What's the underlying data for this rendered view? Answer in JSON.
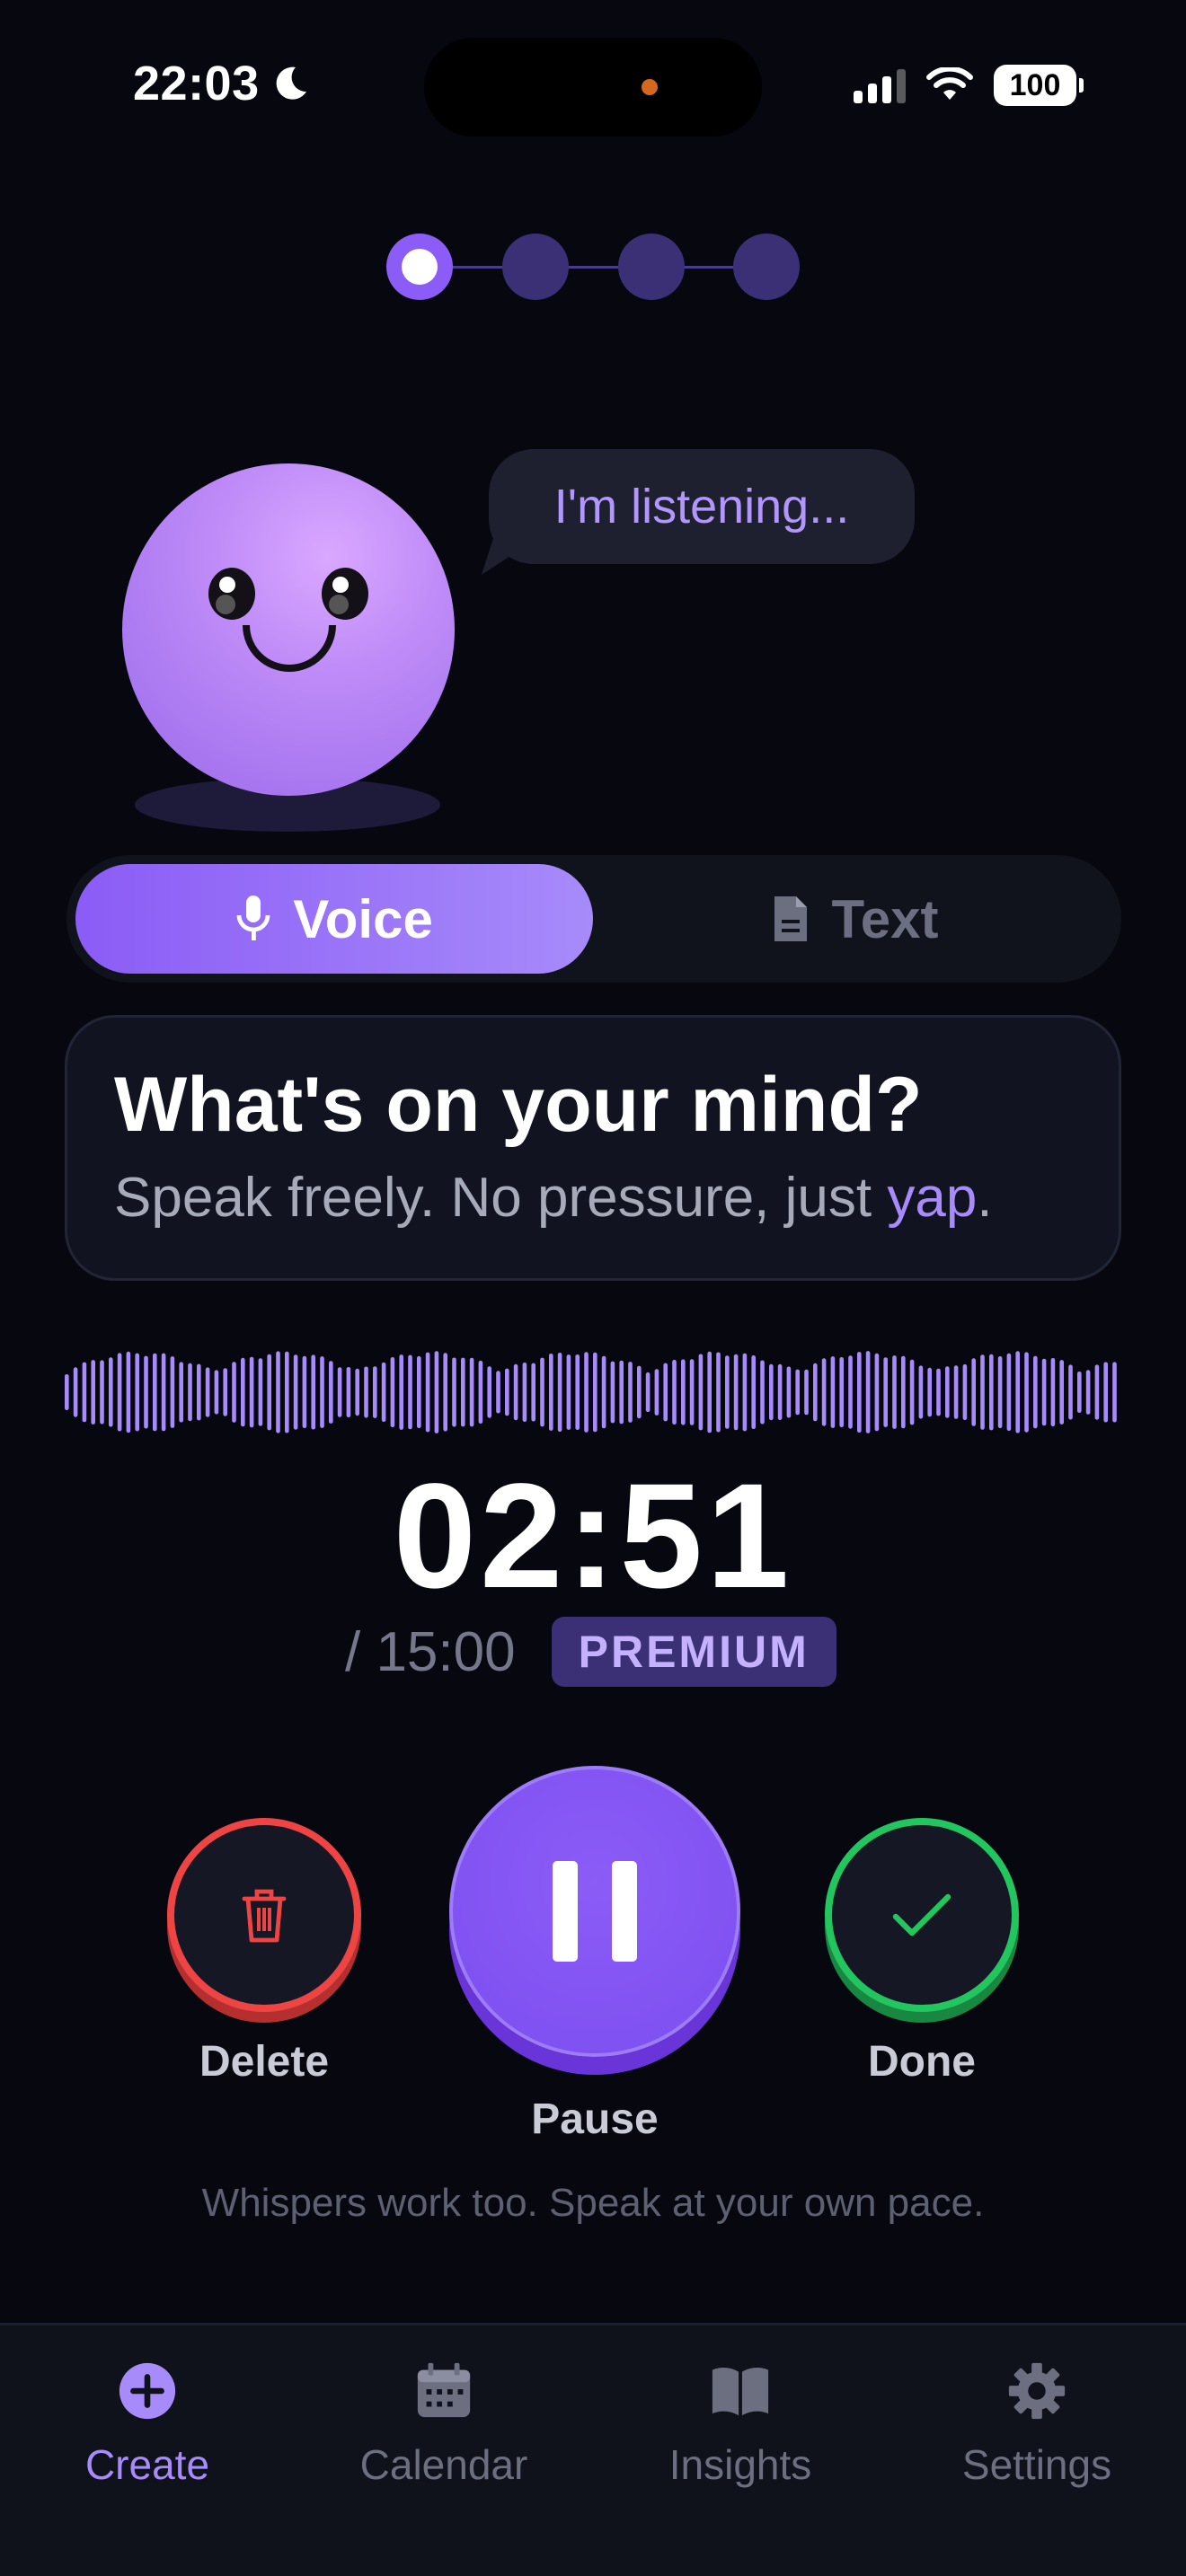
{
  "status_bar": {
    "time": "22:03",
    "battery": "100"
  },
  "stepper": {
    "total_steps": 4,
    "current_step": 1
  },
  "mascot": {
    "speech": "I'm listening..."
  },
  "mode_toggle": {
    "voice_label": "Voice",
    "text_label": "Text",
    "selected": "Voice"
  },
  "prompt": {
    "title": "What's on your mind?",
    "subtitle_prefix": "Speak freely. No pressure, just ",
    "subtitle_highlight": "yap",
    "subtitle_suffix": "."
  },
  "recording": {
    "elapsed": "02:51",
    "limit": "/ 15:00",
    "tier_badge": "PREMIUM"
  },
  "controls": {
    "delete_label": "Delete",
    "pause_label": "Pause",
    "done_label": "Done"
  },
  "hint": "Whispers work too. Speak at your own pace.",
  "tabs": [
    {
      "label": "Create",
      "icon": "plus-circle-icon",
      "active": true
    },
    {
      "label": "Calendar",
      "icon": "calendar-icon",
      "active": false
    },
    {
      "label": "Insights",
      "icon": "book-icon",
      "active": false
    },
    {
      "label": "Settings",
      "icon": "gear-icon",
      "active": false
    }
  ],
  "colors": {
    "accent": "#8b5cf6",
    "accent_light": "#a78bfa",
    "delete": "#ef4444",
    "done": "#22c55e",
    "background": "#06070f"
  }
}
